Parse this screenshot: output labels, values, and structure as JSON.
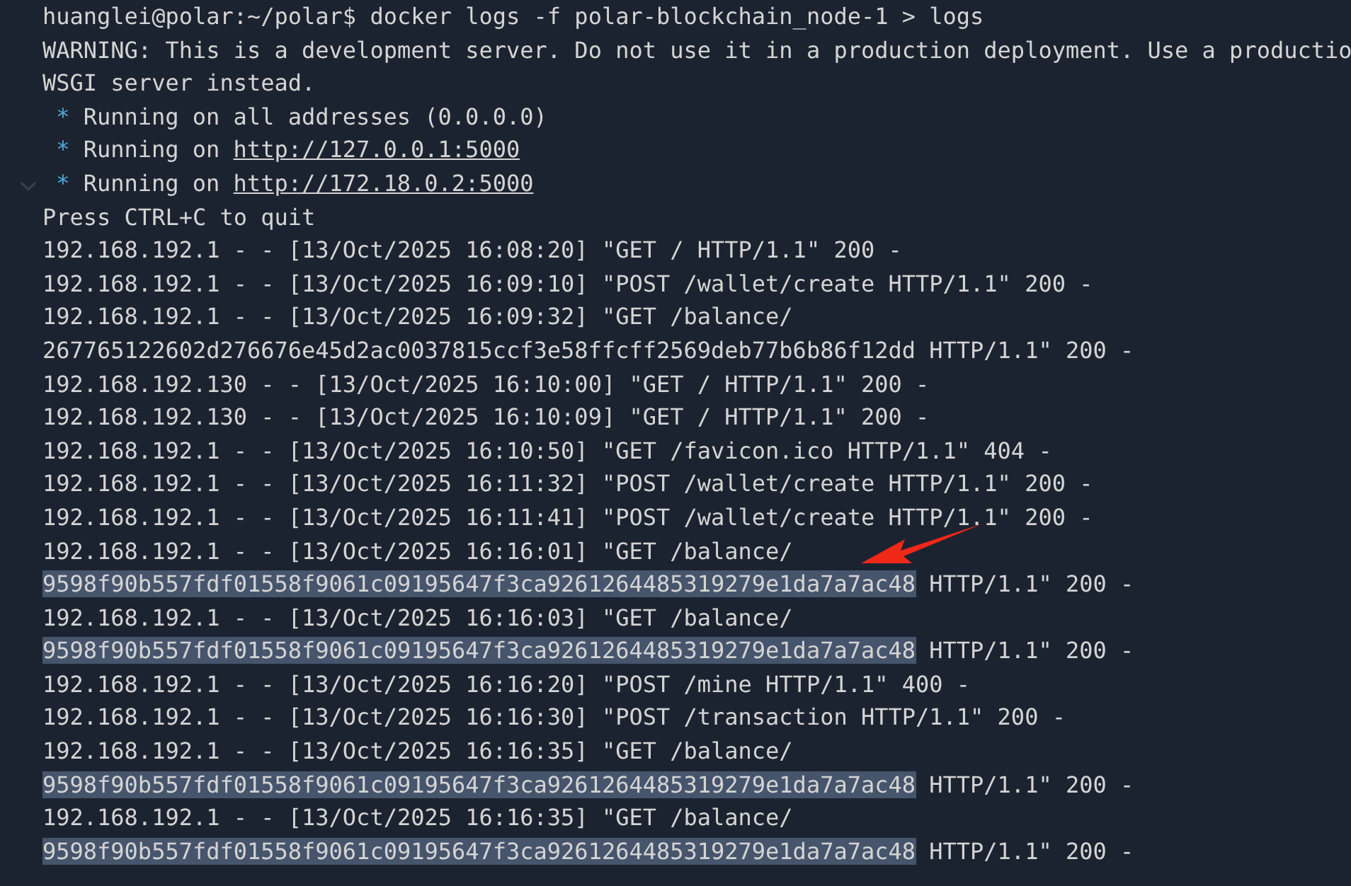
{
  "terminal": {
    "lines": [
      [
        {
          "kind": "plain",
          "text": "huanglei@polar:~/polar$ docker logs -f polar-blockchain_node-1 > logs"
        }
      ],
      [
        {
          "kind": "plain",
          "text": "WARNING: This is a development server. Do not use it in a production deployment. Use a productio"
        }
      ],
      [
        {
          "kind": "plain",
          "text": "WSGI server instead."
        }
      ],
      [
        {
          "kind": "bullet",
          "text": "*"
        },
        {
          "kind": "plain",
          "text": "Running on all addresses (0.0.0.0)"
        }
      ],
      [
        {
          "kind": "bullet",
          "text": "*"
        },
        {
          "kind": "plain",
          "text": "Running on "
        },
        {
          "kind": "link",
          "text": "http://127.0.0.1:5000"
        }
      ],
      [
        {
          "kind": "bullet",
          "text": "*"
        },
        {
          "kind": "plain",
          "text": "Running on "
        },
        {
          "kind": "link",
          "text": "http://172.18.0.2:5000"
        }
      ],
      [
        {
          "kind": "plain",
          "text": "Press CTRL+C to quit"
        }
      ],
      [
        {
          "kind": "plain",
          "text": "192.168.192.1 - - [13/Oct/2025 16:08:20] \"GET / HTTP/1.1\" 200 -"
        }
      ],
      [
        {
          "kind": "plain",
          "text": "192.168.192.1 - - [13/Oct/2025 16:09:10] \"POST /wallet/create HTTP/1.1\" 200 -"
        }
      ],
      [
        {
          "kind": "plain",
          "text": "192.168.192.1 - - [13/Oct/2025 16:09:32] \"GET /balance/"
        }
      ],
      [
        {
          "kind": "plain",
          "text": "267765122602d276676e45d2ac0037815ccf3e58ffcff2569deb77b6b86f12dd HTTP/1.1\" 200 -"
        }
      ],
      [
        {
          "kind": "plain",
          "text": "192.168.192.130 - - [13/Oct/2025 16:10:00] \"GET / HTTP/1.1\" 200 -"
        }
      ],
      [
        {
          "kind": "plain",
          "text": "192.168.192.130 - - [13/Oct/2025 16:10:09] \"GET / HTTP/1.1\" 200 -"
        }
      ],
      [
        {
          "kind": "plain",
          "text": "192.168.192.1 - - [13/Oct/2025 16:10:50] \"GET /favicon.ico HTTP/1.1\" 404 -"
        }
      ],
      [
        {
          "kind": "plain",
          "text": "192.168.192.1 - - [13/Oct/2025 16:11:32] \"POST /wallet/create HTTP/1.1\" 200 -"
        }
      ],
      [
        {
          "kind": "plain",
          "text": "192.168.192.1 - - [13/Oct/2025 16:11:41] \"POST /wallet/create HTTP/1.1\" 200 -"
        }
      ],
      [
        {
          "kind": "plain",
          "text": "192.168.192.1 - - [13/Oct/2025 16:16:01] \"GET /balance/"
        }
      ],
      [
        {
          "kind": "selected",
          "text": "9598f90b557fdf01558f9061c09195647f3ca9261264485319279e1da7a7ac48"
        },
        {
          "kind": "plain",
          "text": " HTTP/1.1\" 200 -"
        }
      ],
      [
        {
          "kind": "plain",
          "text": "192.168.192.1 - - [13/Oct/2025 16:16:03] \"GET /balance/"
        }
      ],
      [
        {
          "kind": "selected",
          "text": "9598f90b557fdf01558f9061c09195647f3ca9261264485319279e1da7a7ac48"
        },
        {
          "kind": "plain",
          "text": " HTTP/1.1\" 200 -"
        }
      ],
      [
        {
          "kind": "plain",
          "text": "192.168.192.1 - - [13/Oct/2025 16:16:20] \"POST /mine HTTP/1.1\" 400 -"
        }
      ],
      [
        {
          "kind": "plain",
          "text": "192.168.192.1 - - [13/Oct/2025 16:16:30] \"POST /transaction HTTP/1.1\" 200 -"
        }
      ],
      [
        {
          "kind": "plain",
          "text": "192.168.192.1 - - [13/Oct/2025 16:16:35] \"GET /balance/"
        }
      ],
      [
        {
          "kind": "selected",
          "text": "9598f90b557fdf01558f9061c09195647f3ca9261264485319279e1da7a7ac48"
        },
        {
          "kind": "plain",
          "text": " HTTP/1.1\" 200 -"
        }
      ],
      [
        {
          "kind": "plain",
          "text": "192.168.192.1 - - [13/Oct/2025 16:16:35] \"GET /balance/"
        }
      ],
      [
        {
          "kind": "selected",
          "text": "9598f90b557fdf01558f9061c09195647f3ca9261264485319279e1da7a7ac48"
        },
        {
          "kind": "plain",
          "text": " HTTP/1.1\" 200 -"
        }
      ]
    ]
  }
}
